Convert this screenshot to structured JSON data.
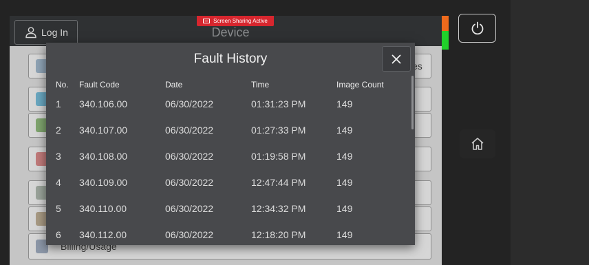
{
  "screen": {
    "title": "Device",
    "login_label": "Log In",
    "sharing_badge": "Screen Sharing Active"
  },
  "background": {
    "partial_tile_text": "es",
    "partial_last_item": "Billing/Usage"
  },
  "modal": {
    "title": "Fault History",
    "columns": [
      "No.",
      "Fault Code",
      "Date",
      "Time",
      "Image Count"
    ],
    "rows": [
      {
        "no": "1",
        "code": "340.106.00",
        "date": "06/30/2022",
        "time": "01:31:23 PM",
        "count": "149"
      },
      {
        "no": "2",
        "code": "340.107.00",
        "date": "06/30/2022",
        "time": "01:27:33 PM",
        "count": "149"
      },
      {
        "no": "3",
        "code": "340.108.00",
        "date": "06/30/2022",
        "time": "01:19:58 PM",
        "count": "149"
      },
      {
        "no": "4",
        "code": "340.109.00",
        "date": "06/30/2022",
        "time": "12:47:44 PM",
        "count": "149"
      },
      {
        "no": "5",
        "code": "340.110.00",
        "date": "06/30/2022",
        "time": "12:34:32 PM",
        "count": "149"
      },
      {
        "no": "6",
        "code": "340.112.00",
        "date": "06/30/2022",
        "time": "12:18:20 PM",
        "count": "149"
      }
    ]
  },
  "colors": {
    "status_orange": "#ef6a1c",
    "status_green": "#21d12a",
    "sharing_red": "#d7262e",
    "modal_bg": "#48494c"
  },
  "icons": [
    "user-icon",
    "screen-share-icon",
    "close-icon",
    "power-icon",
    "home-icon"
  ]
}
